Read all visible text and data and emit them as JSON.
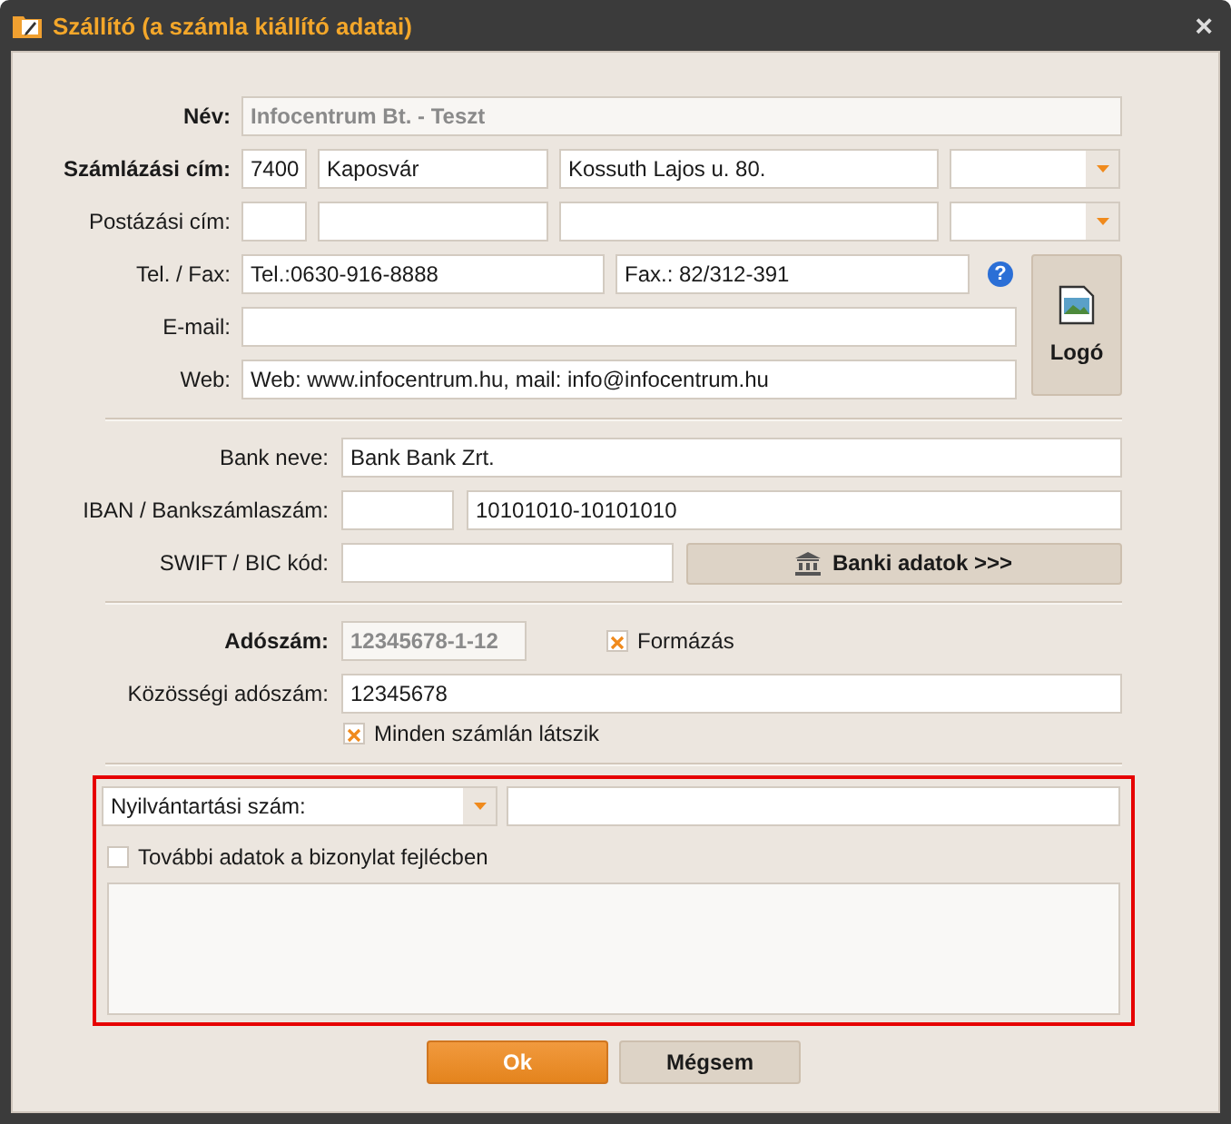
{
  "window": {
    "title": "Szállító (a számla kiállító adatai)",
    "close": "×"
  },
  "name": {
    "label": "Név:",
    "required": true,
    "value": "Infocentrum Bt. - Teszt",
    "disabled": true
  },
  "billing_address": {
    "label": "Számlázási cím:",
    "required": true,
    "zip": "7400",
    "city": "Kaposvár",
    "street": "Kossuth Lajos u. 80."
  },
  "postal_address": {
    "label": "Postázási cím:",
    "required": false
  },
  "phone_fax": {
    "label": "Tel. / Fax:",
    "required": false,
    "phone": "Tel.:0630-916-8888",
    "fax": "Fax.: 82/312-391",
    "help": "?"
  },
  "email": {
    "label": "E-mail:",
    "required": false
  },
  "web": {
    "label": "Web:",
    "required": false,
    "value": "Web: www.infocentrum.hu, mail: info@infocentrum.hu"
  },
  "logo_button": {
    "label": "Logó"
  },
  "bank_name": {
    "label": "Bank neve:",
    "required": false,
    "value": "Bank Bank Zrt."
  },
  "iban": {
    "label": "IBAN / Bankszámlaszám:",
    "required": false,
    "account": "10101010-10101010"
  },
  "swift": {
    "label": "SWIFT / BIC kód:",
    "required": false
  },
  "bank_button": {
    "label": "Banki adatok >>>"
  },
  "tax_number": {
    "label": "Adószám:",
    "required": true,
    "value": "12345678-1-12",
    "disabled": true,
    "format_checkbox": {
      "label": "Formázás",
      "checked": true
    }
  },
  "eu_tax_number": {
    "label": "Közösségi adószám:",
    "required": false,
    "value": "12345678",
    "show_checkbox": {
      "label": "Minden számlán látszik",
      "checked": true
    }
  },
  "registration": {
    "highlighted": true,
    "select": "Nyilvántartási szám:",
    "extra_checkbox": {
      "label": "További adatok a bizonylat fejlécben",
      "checked": false
    }
  },
  "buttons": [
    {
      "label": "Ok",
      "kind": "primary"
    },
    {
      "label": "Mégsem",
      "kind": "secondary"
    }
  ]
}
